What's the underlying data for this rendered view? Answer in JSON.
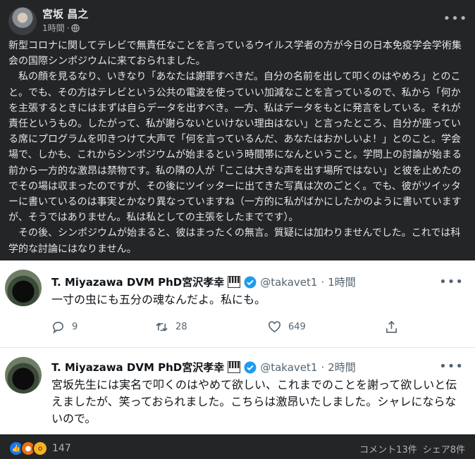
{
  "post": {
    "author": "宮坂 昌之",
    "time": "1時間",
    "separator": "·",
    "body": "新型コロナに関してテレビで無責任なことを言っているウイルス学者の方が今日の日本免疫学会学術集会の国際シンポジウムに来ておられました。\n　私の顔を見るなり、いきなり「あなたは謝罪すべきだ。自分の名前を出して叩くのはやめろ」とのこと。でも、その方はテレビという公共の電波を使っていい加減なことを言っているので、私から「何かを主張するときにはまずは自らデータを出すべき。一方、私はデータをもとに発言をしている。それが責任というもの。したがって、私が謝らないといけない理由はない」と言ったところ、自分が座っている席にプログラムを叩きつけて大声で「何を言っているんだ、あなたはおかしいよ！」とのこと。学会場で、しかも、これからシンポジウムが始まるという時間帯になんということ。学問上の討論が始まる前から一方的な激昂は禁物です。私の隣の人が「ここは大きな声を出す場所ではない」と彼を止めたのでその場は収まったのですが、その後にツイッターに出てきた写真は次のごとく。でも、彼がツイッターに書いているのは事実とかなり異なっていますね（一方的に私がばかにしたかのように書いていますが、そうではありません。私は私としての主張をしたまでです）。\n　その後、シンポジウムが始まると、彼はまったくの無言。質疑には加わりませんでした。これでは科学的な討論にはなりません。",
    "icons": {
      "privacy": "globe-icon",
      "more": "more-options-icon"
    }
  },
  "tweets": [
    {
      "name": "T. Miyazawa DVM PhD宮沢孝幸",
      "handle": "@takavet1",
      "sep": "·",
      "time": "1時間",
      "text": "一寸の虫にも五分の魂なんだよ。私にも。",
      "replies": "9",
      "retweets": "28",
      "likes": "649"
    },
    {
      "name": "T. Miyazawa DVM PhD宮沢孝幸",
      "handle": "@takavet1",
      "sep": "·",
      "time": "2時間",
      "text": "宮坂先生には実名で叩くのはやめて欲しい、これまでのことを謝って欲しいと伝えましたが、笑っておられました。こちらは激昂いたしました。シャレにならないので。"
    }
  ],
  "footer": {
    "reaction_count": "147",
    "reactions": [
      "like",
      "angry",
      "wow"
    ],
    "comments": "コメント13件",
    "shares": "シェア8件"
  },
  "colors": {
    "fb_bg": "#242526",
    "twitter_blue": "#1d9bf0",
    "like_blue": "#1877f2"
  }
}
